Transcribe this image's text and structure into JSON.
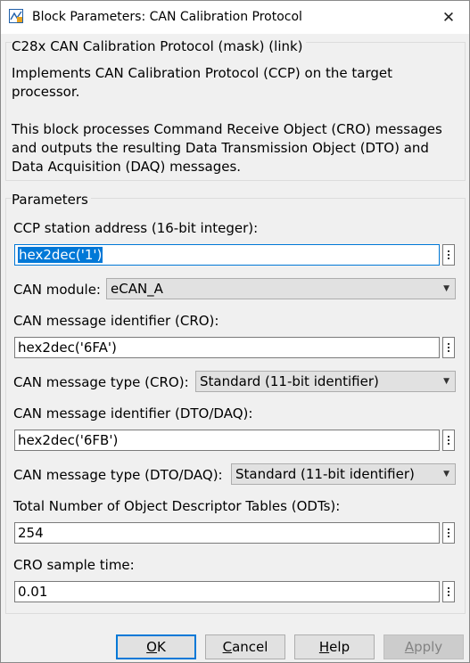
{
  "window": {
    "title": "Block Parameters: CAN Calibration Protocol",
    "close_glyph": "✕",
    "app_icon": "simulink-block-icon"
  },
  "description": {
    "legend": "C28x CAN Calibration Protocol (mask) (link)",
    "line1": "Implements CAN Calibration Protocol (CCP) on the target",
    "line2": "processor.",
    "line3": "This block processes Command Receive Object (CRO) messages",
    "line4": "and outputs the resulting Data Transmission Object (DTO) and",
    "line5": "Data Acquisition (DAQ) messages."
  },
  "parameters": {
    "legend": "Parameters",
    "station_address": {
      "label": "CCP station address (16-bit integer):",
      "value": "hex2dec('1')"
    },
    "can_module": {
      "label": "CAN module:",
      "value": "eCAN_A"
    },
    "cro_identifier": {
      "label": "CAN message identifier (CRO):",
      "value": "hex2dec('6FA')"
    },
    "cro_type": {
      "label": "CAN message type (CRO):",
      "value": "Standard (11-bit identifier)"
    },
    "dto_identifier": {
      "label": "CAN message identifier (DTO/DAQ):",
      "value": "hex2dec('6FB')"
    },
    "dto_type": {
      "label": "CAN message type (DTO/DAQ):",
      "value": "Standard (11-bit identifier)"
    },
    "odt_count": {
      "label": "Total Number of Object Descriptor Tables (ODTs):",
      "value": "254"
    },
    "cro_sample_time": {
      "label": "CRO sample time:",
      "value": "0.01"
    }
  },
  "buttons": {
    "ok": {
      "mnemonic": "O",
      "rest": "K"
    },
    "cancel": {
      "mnemonic": "C",
      "rest": "ancel"
    },
    "help": {
      "mnemonic": "H",
      "rest": "elp"
    },
    "apply": {
      "mnemonic": "A",
      "rest": "pply"
    }
  },
  "colors": {
    "accent": "#0078d7",
    "face": "#f0f0f0"
  }
}
